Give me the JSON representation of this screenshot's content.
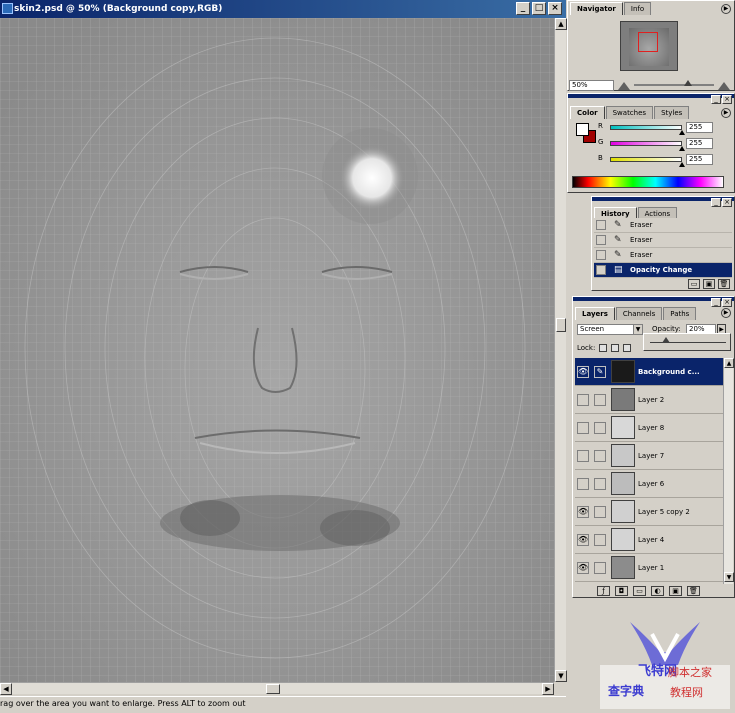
{
  "document": {
    "title": "skin2.psd @ 50% (Background copy,RGB)",
    "buttons": {
      "minimize": "_",
      "maximize": "□",
      "close": "×"
    }
  },
  "status": {
    "text": "rag over the area you want to enlarge. Press ALT to zoom out"
  },
  "navigator": {
    "tabs": [
      "Navigator",
      "Info"
    ],
    "zoom": "50%"
  },
  "color": {
    "tabs": [
      "Color",
      "Swatches",
      "Styles"
    ],
    "channels": [
      {
        "label": "R",
        "value": "255",
        "gradient": "#00c0c0"
      },
      {
        "label": "G",
        "value": "255",
        "gradient": "#e000e0"
      },
      {
        "label": "B",
        "value": "255",
        "gradient": "#e0e000"
      }
    ],
    "foreground": "#ffffff",
    "background": "#a00000"
  },
  "history": {
    "tabs": [
      "History",
      "Actions"
    ],
    "items": [
      {
        "label": "Eraser",
        "selected": false
      },
      {
        "label": "Eraser",
        "selected": false
      },
      {
        "label": "Eraser",
        "selected": false
      },
      {
        "label": "Opacity Change",
        "selected": true
      }
    ]
  },
  "layers": {
    "tabs": [
      "Layers",
      "Channels",
      "Paths"
    ],
    "blend_mode": "Screen",
    "opacity_label": "Opacity:",
    "opacity_value": "20%",
    "lock_label": "Lock:",
    "items": [
      {
        "name": "Background c...",
        "visible": true,
        "selected": true
      },
      {
        "name": "Layer 2",
        "visible": false,
        "selected": false
      },
      {
        "name": "Layer 8",
        "visible": false,
        "selected": false
      },
      {
        "name": "Layer 7",
        "visible": false,
        "selected": false
      },
      {
        "name": "Layer 6",
        "visible": false,
        "selected": false
      },
      {
        "name": "Layer 5 copy 2",
        "visible": true,
        "selected": false
      },
      {
        "name": "Layer 4",
        "visible": true,
        "selected": false
      },
      {
        "name": "Layer 1",
        "visible": true,
        "selected": false
      }
    ]
  },
  "watermark": {
    "lines": [
      "飞特网",
      "脚本之家",
      "查字典",
      "教程网"
    ]
  }
}
